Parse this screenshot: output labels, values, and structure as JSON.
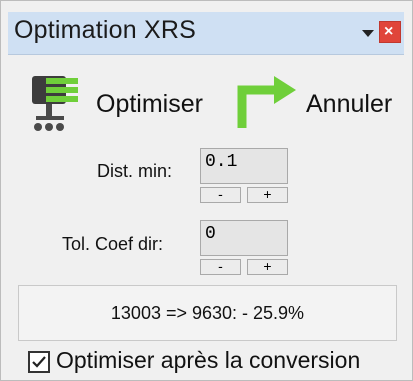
{
  "window": {
    "title": "Optimation XRS"
  },
  "toolbar": {
    "optimize_label": "Optimiser",
    "optimize_icon": "compress-icon",
    "cancel_label": "Annuler",
    "cancel_icon": "turn-arrow-icon"
  },
  "params": {
    "dist_min": {
      "label": "Dist. min:",
      "value": "0.1",
      "dec_label": "-",
      "inc_label": "+"
    },
    "tol_coef": {
      "label": "Tol. Coef dir:",
      "value": "0",
      "dec_label": "-",
      "inc_label": "+"
    }
  },
  "result": {
    "text": "13003 => 9630:  - 25.9%"
  },
  "options": {
    "optimize_after_conversion": {
      "label": "Optimiser après la conversion",
      "checked": true
    }
  },
  "colors": {
    "titlebar": "#cfe0f3",
    "close_button": "#e0453a",
    "icon_green": "#6fcf3a",
    "icon_gray": "#4a4a4a"
  }
}
